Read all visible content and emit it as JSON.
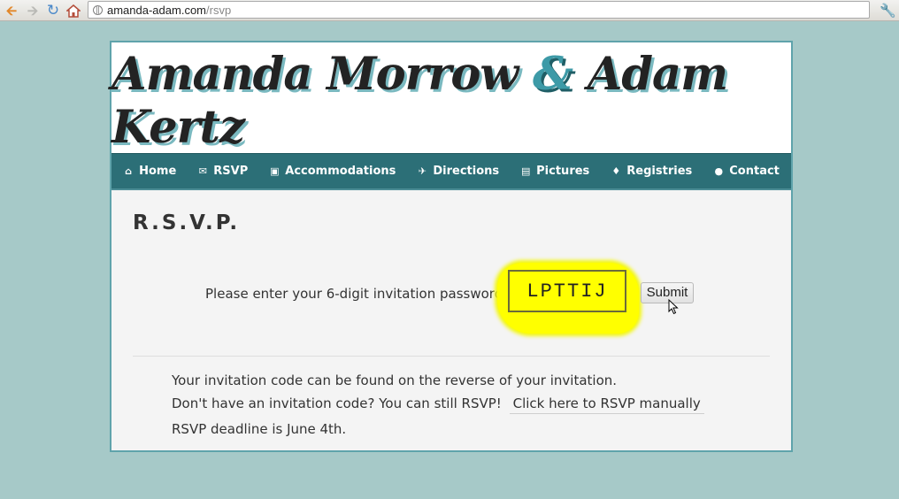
{
  "browser": {
    "url_host": "amanda-adam.com",
    "url_path": "/rsvp"
  },
  "header": {
    "name_left": "Amanda Morrow",
    "ampersand": "&",
    "name_right": "Adam Kertz"
  },
  "nav": {
    "items": [
      {
        "label": "Home",
        "icon": "home-icon"
      },
      {
        "label": "RSVP",
        "icon": "envelope-icon"
      },
      {
        "label": "Accommodations",
        "icon": "suitcase-icon"
      },
      {
        "label": "Directions",
        "icon": "airplane-icon"
      },
      {
        "label": "Pictures",
        "icon": "photo-icon"
      },
      {
        "label": "Registries",
        "icon": "tag-icon"
      },
      {
        "label": "Contact",
        "icon": "speech-bubble-icon"
      }
    ]
  },
  "rsvp": {
    "title": "R.S.V.P.",
    "prompt": "Please enter your 6-digit invitation password:",
    "password_value": "LPTTIJ",
    "submit_label": "Submit",
    "info_line1": "Your invitation code can be found on the reverse of your invitation.",
    "info_line2": "Don't have an invitation code? You can still RSVP!",
    "manual_link": "Click here to RSVP manually",
    "deadline": "RSVP deadline is June 4th."
  },
  "colors": {
    "page_bg": "#a6c9c8",
    "nav_bg": "#2c6f77",
    "accent_teal": "#3d9aa7",
    "highlight": "#ffff00"
  }
}
